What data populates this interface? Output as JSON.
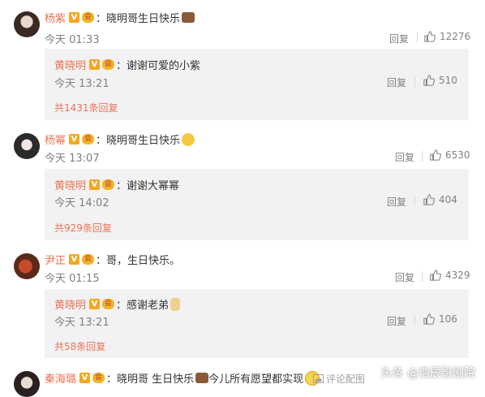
{
  "comments": [
    {
      "user": "杨紫",
      "text": "晓明哥生日快乐",
      "emoji": "cake-emoji",
      "time": "今天 01:33",
      "reply_label": "回复",
      "likes": "12276",
      "reply": {
        "user": "黄晓明",
        "text": "谢谢可爱的小紫",
        "time": "今天 13:21",
        "reply_label": "回复",
        "likes": "510"
      },
      "total": "共1431条回复"
    },
    {
      "user": "杨幂",
      "text": "晓明哥生日快乐",
      "emoji": "shocked-face-emoji",
      "time": "今天 13:07",
      "reply_label": "回复",
      "likes": "6530",
      "reply": {
        "user": "黄晓明",
        "text": "谢谢大幂幂",
        "time": "今天 14:02",
        "reply_label": "回复",
        "likes": "404"
      },
      "total": "共929条回复"
    },
    {
      "user": "尹正",
      "text": "哥，生日快乐。",
      "emoji": "",
      "time": "今天 01:15",
      "reply_label": "回复",
      "likes": "4329",
      "reply": {
        "user": "黄晓明",
        "text": "感谢老弟",
        "time": "今天 13:21",
        "reply_label": "回复",
        "likes": "106"
      },
      "total": "共58条回复"
    },
    {
      "user": "秦海璐",
      "text": "晓明哥 生日快乐",
      "text2": "今儿所有愿望都实现",
      "comment_link": "评论配图"
    }
  ],
  "badge_v": "V",
  "badge_vip": "会",
  "watermark": "头条 @浩辰影剧院"
}
